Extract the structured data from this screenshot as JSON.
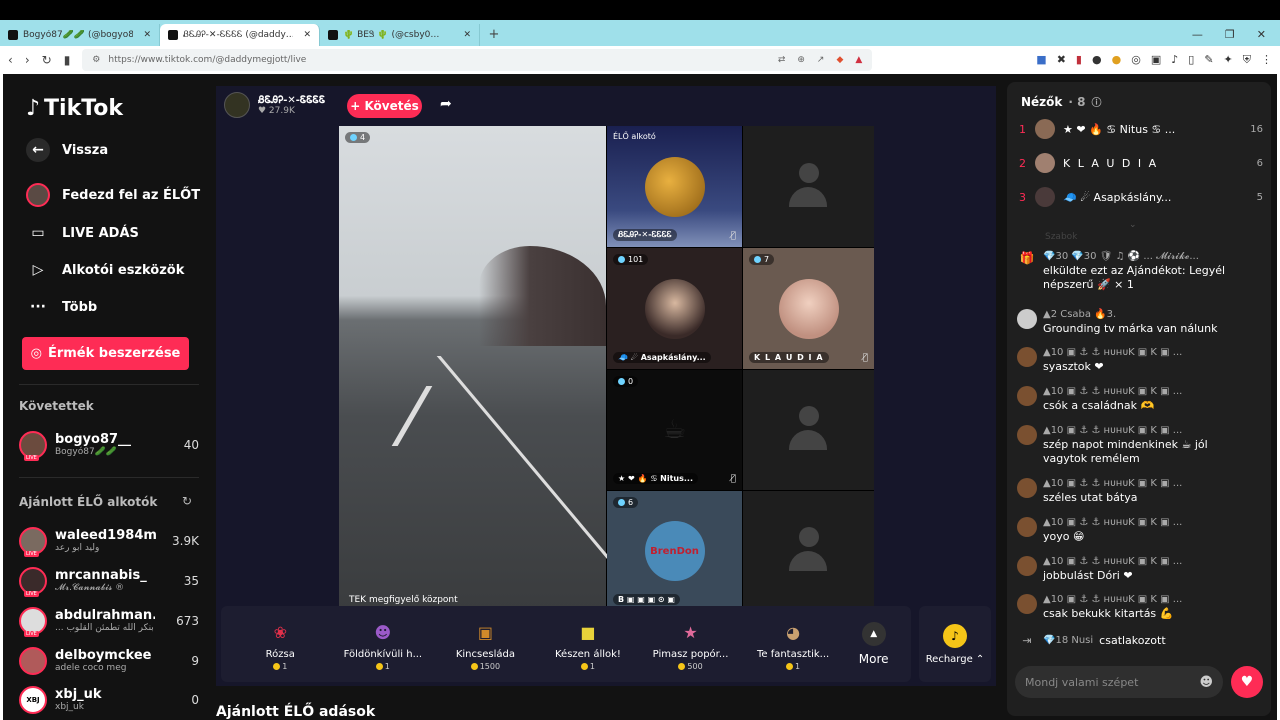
{
  "browser": {
    "tabs": [
      {
        "label": "Bogyó87🥒🥒 (@bogyo87__) Él…",
        "active": false
      },
      {
        "label": "ᏰᏋᎯᎮ-✕-ᏋᏋᏋᏋ (@daddy…",
        "active": true
      },
      {
        "label": "🌵 BEᏕ 🌵 (@csby0…",
        "active": false
      }
    ],
    "new_tab": "+",
    "url": "https://www.tiktok.com/@daddymegjott/live"
  },
  "sidebar": {
    "logo": "TikTok",
    "nav": [
      {
        "label": "Vissza",
        "icon": "back-icon"
      },
      {
        "label": "Fedezd fel az ÉLŐT",
        "icon": "explore-live-icon"
      },
      {
        "label": "LIVE ADÁS",
        "icon": "camera-icon"
      },
      {
        "label": "Alkotói eszközök",
        "icon": "creator-tools-icon"
      },
      {
        "label": "Több",
        "icon": "more-dots-icon"
      }
    ],
    "coins_button": "Érmék beszerzése",
    "following_title": "Követettek",
    "following": [
      {
        "name": "bogyo87__",
        "sub": "Bogyó87🥒🥒",
        "count": "40"
      }
    ],
    "recommended_title": "Ajánlott ÉLŐ alkotók",
    "recommended": [
      {
        "name": "waleed1984m",
        "sub": "وليد ابو رعد",
        "count": "3.9K"
      },
      {
        "name": "mrcannabis_",
        "sub": "𝓜𝓻.𝓒𝓪𝓷𝓷𝓪𝓫𝓲𝓼 ®",
        "count": "35"
      },
      {
        "name": "abdulrahman...",
        "sub": "... الا بنكر الله تطمئن القلوب",
        "count": "673"
      },
      {
        "name": "delboymckee",
        "sub": "adele coco meg",
        "count": "9"
      },
      {
        "name": "xbj_uk",
        "sub": "xbj_uk",
        "count": "0"
      }
    ]
  },
  "host": {
    "name": "ᏰᏋᎯᎮ-✕-ᏋᏋᏋᏋ",
    "likes": "♥ 27.9K",
    "follow_label": "+ Követés"
  },
  "video": {
    "main_viewers": "4",
    "main_label": "TEK megfigyelő központ",
    "cells": [
      {
        "top_label": "ÉLŐ alkotó",
        "bottom_label": "ᏰᏋᎯᎮ-✕-ᏋᏋᏋᏋ"
      },
      {
        "viewers": "101",
        "bottom_label": "🧢 ☄ Asapkáslány..."
      },
      {
        "viewers": "7",
        "bottom_label": "K L A U D I A"
      },
      {
        "viewers": "0",
        "bottom_label": "★ ❤ 🔥 ♋ Nitus..."
      },
      {
        "viewers": "6",
        "bottom_label": "B ▣ ▣ ▣ ⊙ ▣",
        "logo_text": "BrenDon"
      }
    ]
  },
  "gifts": [
    {
      "name": "Rózsa",
      "price": "1",
      "icon": "rose-icon",
      "color": "#e0304a"
    },
    {
      "name": "Földönkívüli h...",
      "price": "1",
      "icon": "alien-icon",
      "color": "#9b5ac8"
    },
    {
      "name": "Kincsesláda",
      "price": "1500",
      "icon": "chest-icon",
      "color": "#d08a2a"
    },
    {
      "name": "Készen állok!",
      "price": "1",
      "icon": "sponge-icon",
      "color": "#e8d23a"
    },
    {
      "name": "Pimasz popór...",
      "price": "500",
      "icon": "starfish-icon",
      "color": "#e06a9a"
    },
    {
      "name": "Te fantasztik...",
      "price": "1",
      "icon": "hamster-icon",
      "color": "#c8a070"
    }
  ],
  "gifts_more": "More",
  "recharge": "Recharge ⌃",
  "bottom_title": "Ajánlott ÉLŐ adások",
  "chat": {
    "viewers_title": "Nézők",
    "viewers_count": "· 8",
    "top_viewers": [
      {
        "rank": "1",
        "name": "★ ❤ 🔥 ♋ Nitus ♋ ...",
        "score": "16"
      },
      {
        "rank": "2",
        "name": "K L A U D I A",
        "score": "6"
      },
      {
        "rank": "3",
        "name": "🧢 ☄ Asapkáslány...",
        "score": "5"
      }
    ],
    "faded_line": "Szabok",
    "messages": [
      {
        "user": "💎30 💎30 🛡 ♫ ⚽ ... 𝓜𝓲𝓻𝓲𝓴𝓮...",
        "text": "elküldte ezt az Ajándékot: Legyél népszerű 🚀 × 1",
        "gift": true
      },
      {
        "user": "▲2 Csaba 🔥3.",
        "text": "Grounding tv márka van nálunk"
      },
      {
        "user": "▲10 ▣ ⚓ ⚓ ʜᴜʜᴜK ▣ K ▣ ...",
        "text": "syasztok ❤"
      },
      {
        "user": "▲10 ▣ ⚓ ⚓ ʜᴜʜᴜK ▣ K ▣ ...",
        "text": "csók a családnak 🫶"
      },
      {
        "user": "▲10 ▣ ⚓ ⚓ ʜᴜʜᴜK ▣ K ▣ ...",
        "text": "szép napot mindenkinek ☕ jól vagytok remélem"
      },
      {
        "user": "▲10 ▣ ⚓ ⚓ ʜᴜʜᴜK ▣ K ▣ ...",
        "text": "széles utat bátya"
      },
      {
        "user": "▲10 ▣ ⚓ ⚓ ʜᴜʜᴜK ▣ K ▣ ...",
        "text": "yoyo 😁"
      },
      {
        "user": "▲10 ▣ ⚓ ⚓ ʜᴜʜᴜK ▣ K ▣ ...",
        "text": "jobbulást Dóri ❤"
      },
      {
        "user": "▲10 ▣ ⚓ ⚓ ʜᴜʜᴜK ▣ K ▣ ...",
        "text": "csak bekukk kitartás 💪"
      }
    ],
    "join_user": "💎18 Nusi",
    "join_text": "csatlakozott",
    "input_placeholder": "Mondj valami szépet"
  }
}
